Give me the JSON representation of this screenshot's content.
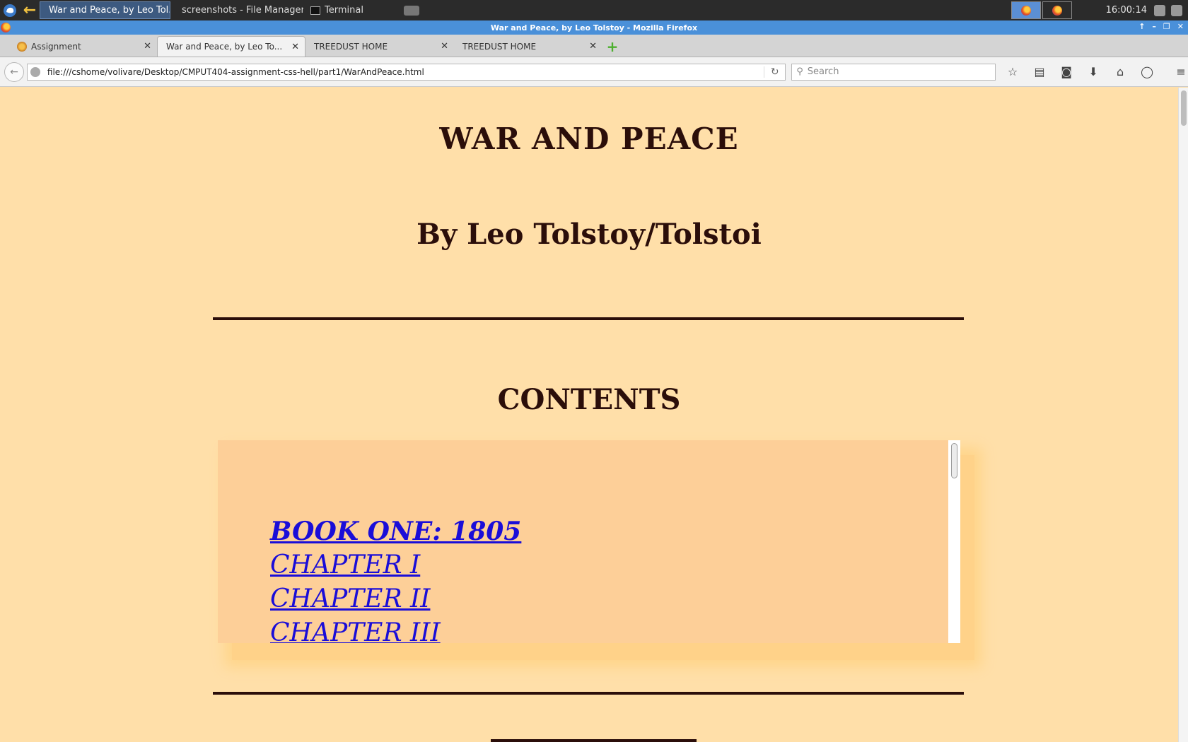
{
  "taskbar": {
    "tasks": [
      {
        "label": "War and Peace, by Leo Tol...",
        "icon": "firefox-icon",
        "active": true
      },
      {
        "label": "screenshots - File Manager",
        "icon": "folder-icon",
        "active": false
      },
      {
        "label": "Terminal",
        "icon": "terminal-icon",
        "active": false
      }
    ],
    "clock": "16:00:14"
  },
  "window": {
    "title": "War and Peace, by Leo Tolstoy - Mozilla Firefox"
  },
  "tabs": [
    {
      "label": "Assignment",
      "active": false
    },
    {
      "label": "War and Peace, by Leo To...",
      "active": true
    },
    {
      "label": "TREEDUST HOME",
      "active": false
    },
    {
      "label": "TREEDUST HOME",
      "active": false
    }
  ],
  "navbar": {
    "url": "file:///cshome/volivare/Desktop/CMPUT404-assignment-css-hell/part1/WarAndPeace.html",
    "search_placeholder": "Search"
  },
  "page": {
    "title": "WAR AND PEACE",
    "author": "By Leo Tolstoy/Tolstoi",
    "contents_heading": "CONTENTS",
    "toc": [
      {
        "label": "BOOK ONE: 1805",
        "type": "book"
      },
      {
        "label": "CHAPTER I",
        "type": "chapter"
      },
      {
        "label": "CHAPTER II",
        "type": "chapter"
      },
      {
        "label": "CHAPTER III",
        "type": "chapter"
      }
    ]
  },
  "colors": {
    "page_background": "#ffdfa9",
    "toc_background": "#fdcf98",
    "heading_text": "#2b0e0a",
    "link": "#1a0dd8",
    "titlebar": "#4a90d9"
  }
}
